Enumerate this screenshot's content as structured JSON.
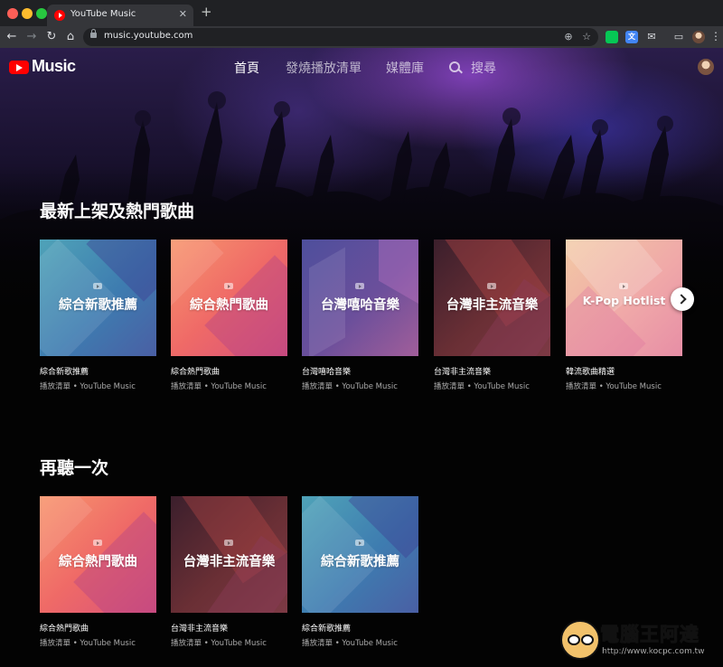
{
  "browser": {
    "tab_title": "YouTube Music",
    "tab_close": "✕",
    "new_tab": "+",
    "url": "music.youtube.com",
    "back": "←",
    "forward": "→",
    "reload": "↻",
    "home": "⌂",
    "omni_right_1": "⊕",
    "bookmark": "☆",
    "ext_line_label": "LINE",
    "ext_translate_label": "文",
    "ext_mail": "✉",
    "cast": "▭",
    "menu": "⋮"
  },
  "app": {
    "logo_text": "Music",
    "nav": {
      "home": "首頁",
      "hotlist": "發燒播放清單",
      "library": "媒體庫",
      "search": "搜尋"
    }
  },
  "sections": [
    {
      "title": "最新上架及熱門歌曲",
      "cards": [
        {
          "thumb_text": "綜合新歌推薦",
          "title": "綜合新歌推薦",
          "subtitle": "播放清單 • YouTube Music"
        },
        {
          "thumb_text": "綜合熱門歌曲",
          "title": "綜合熱門歌曲",
          "subtitle": "播放清單 • YouTube Music"
        },
        {
          "thumb_text": "台灣嘻哈音樂",
          "title": "台灣嘻哈音樂",
          "subtitle": "播放清單 • YouTube Music"
        },
        {
          "thumb_text": "台灣非主流音樂",
          "title": "台灣非主流音樂",
          "subtitle": "播放清單 • YouTube Music"
        },
        {
          "thumb_text": "K-Pop Hotlist",
          "title": "韓流歌曲精選",
          "subtitle": "播放清單 • YouTube Music"
        }
      ]
    },
    {
      "title": "再聽一次",
      "cards": [
        {
          "thumb_text": "綜合熱門歌曲",
          "title": "綜合熱門歌曲",
          "subtitle": "播放清單 • YouTube Music"
        },
        {
          "thumb_text": "台灣非主流音樂",
          "title": "台灣非主流音樂",
          "subtitle": "播放清單 • YouTube Music"
        },
        {
          "thumb_text": "綜合新歌推薦",
          "title": "綜合新歌推薦",
          "subtitle": "播放清單 • YouTube Music"
        }
      ]
    }
  ],
  "watermark": {
    "text": "電腦王阿達",
    "url": "http://www.kocpc.com.tw"
  },
  "colors": {
    "brand_red": "#ff0000",
    "background": "#030303",
    "chrome_dark": "#202124",
    "chrome_toolbar": "#35363a"
  }
}
